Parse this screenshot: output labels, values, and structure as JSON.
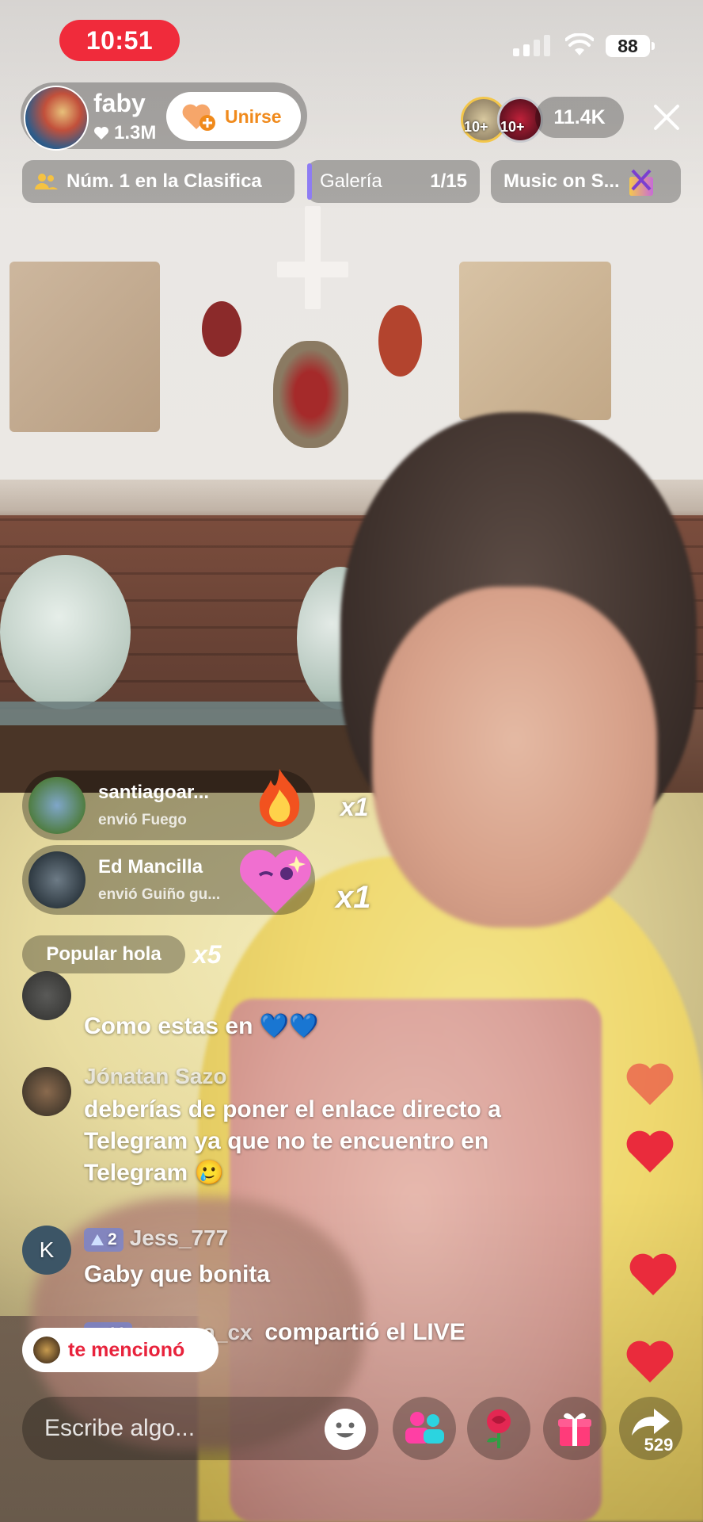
{
  "status_bar": {
    "time": "10:51",
    "battery": "88"
  },
  "host": {
    "name": "faby",
    "likes": "1.3M",
    "join_label": "Unirse"
  },
  "viewers": {
    "badge_a": "10+",
    "badge_b": "10+",
    "count": "11.4K"
  },
  "pills": {
    "rank": "Núm. 1 en la Clasifica",
    "gallery_label": "Galería",
    "gallery_count": "1/15",
    "music": "Music on S..."
  },
  "gifts": [
    {
      "user": "santiagoar...",
      "action": "envió Fuego",
      "multiplier": "x1"
    },
    {
      "user": "Ed Mancilla",
      "action": "envió Guiño gu...",
      "multiplier": "x1"
    }
  ],
  "popular": {
    "label": "Popular hola",
    "multiplier": "x5"
  },
  "chat": [
    {
      "user": "",
      "text": "Como estas en 💙💙"
    },
    {
      "user": "Jónatan Sazo",
      "text": "deberías de poner el enlace directo a Telegram ya que no te encuentro en Telegram 🥲"
    },
    {
      "user": "Jess_777",
      "level": "2",
      "avatar_letter": "K",
      "text": "Gaby que bonita"
    },
    {
      "user": "emmaa_cx",
      "level": "10",
      "text": "compartió el LIVE"
    }
  ],
  "mention_label": "te mencionó",
  "input": {
    "placeholder": "Escribe algo..."
  },
  "share_count": "529",
  "colors": {
    "live_red": "#f02b3b",
    "join_orange": "#f08a1c",
    "heart_red": "#ea2b3c",
    "level_blue": "#6e82dc"
  }
}
